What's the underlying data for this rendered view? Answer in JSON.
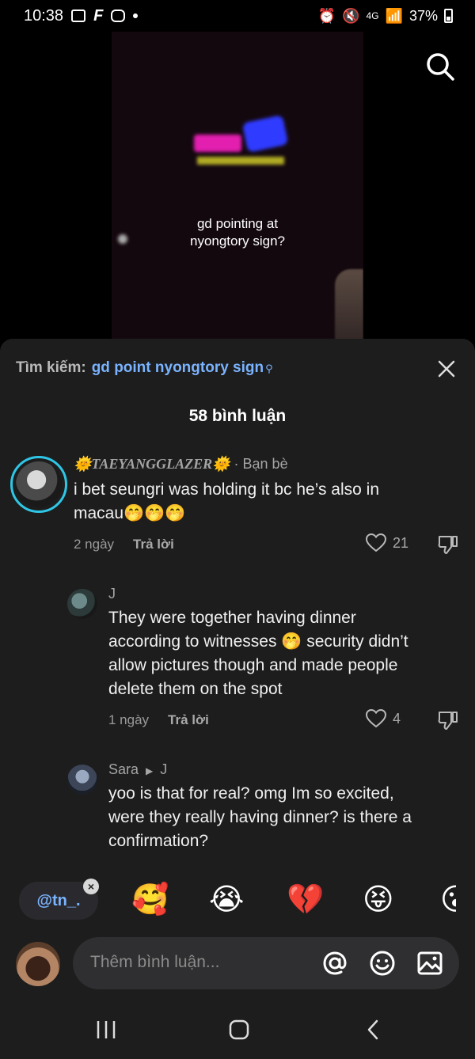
{
  "status_bar": {
    "time": "10:38",
    "network": "4G",
    "battery": "37%"
  },
  "video": {
    "caption_line1": "gd pointing at",
    "caption_line2": "nyongtory sign?"
  },
  "sheet": {
    "search_label": "Tìm kiếm:",
    "search_query": "gd point nyongtory sign",
    "comment_count": "58 bình luận"
  },
  "comments": [
    {
      "username": "🌞TAEYANGGLAZER🌞",
      "tag": "· Bạn bè",
      "text_line1": "i bet seungri was holding it bc he’s also in",
      "text_line2": "macau🤭🤭🤭",
      "time": "2 ngày",
      "reply": "Trả lời",
      "likes": "21"
    },
    {
      "username": "J",
      "text_line1": "They were together having dinner",
      "text_line2": "according to witnesses 🤭 security didn’t",
      "text_line3": "allow pictures though and made people",
      "text_line4": "delete them on the spot",
      "time": "1 ngày",
      "reply": "Trả lời",
      "likes": "4"
    },
    {
      "username": "Sara",
      "reply_to": "J",
      "text_line1": "yoo is that for real? omg Im so excited,",
      "text_line2": "were they really having dinner? is there a",
      "text_line3": "confirmation?"
    }
  ],
  "emoji_bar": {
    "mention_chip": "@tn_.",
    "emojis": [
      "🥰",
      "😭",
      "💔",
      "😝",
      "😮"
    ]
  },
  "input": {
    "placeholder": "Thêm bình luận..."
  },
  "icons": [
    "search-icon",
    "close-icon",
    "heart-icon",
    "dislike-icon",
    "at-icon",
    "smiley-icon",
    "image-icon",
    "recents-icon",
    "home-icon",
    "back-icon"
  ]
}
